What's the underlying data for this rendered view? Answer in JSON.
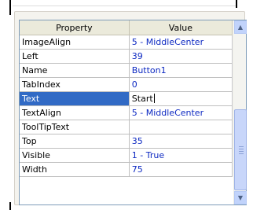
{
  "grid": {
    "header": {
      "property": "Property",
      "value": "Value"
    },
    "rows": [
      {
        "name": "ImageAlign",
        "value": "5 - MiddleCenter"
      },
      {
        "name": "Left",
        "value": "39"
      },
      {
        "name": "Name",
        "value": "Button1"
      },
      {
        "name": "TabIndex",
        "value": "0"
      },
      {
        "name": "Text",
        "value": "Start",
        "selected": true
      },
      {
        "name": "TextAlign",
        "value": "5 - MiddleCenter"
      },
      {
        "name": "ToolTipText",
        "value": ""
      },
      {
        "name": "Top",
        "value": "35"
      },
      {
        "name": "Visible",
        "value": "1 - True"
      },
      {
        "name": "Width",
        "value": "75"
      }
    ]
  },
  "scrollbar": {
    "up_icon": "arrow-up-icon",
    "down_icon": "arrow-down-icon"
  },
  "colors": {
    "selection": "#316ac5",
    "value_text": "#0d29c2",
    "header_bg": "#ebeadb"
  }
}
